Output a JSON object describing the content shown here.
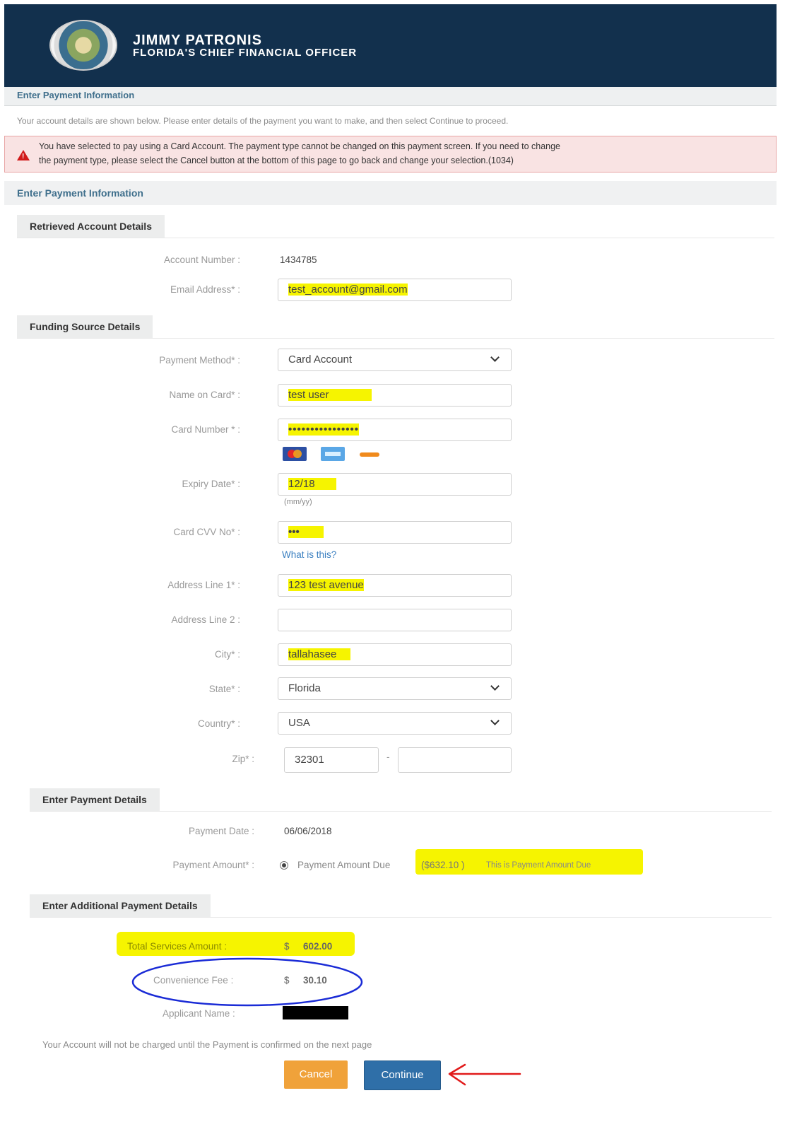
{
  "header": {
    "name": "JIMMY PATRONIS",
    "subtitle": "FLORIDA'S CHIEF FINANCIAL OFFICER"
  },
  "top_title": "Enter Payment Information",
  "intro": "Your account details are shown below. Please enter details of the payment you want to make, and then select Continue to proceed.",
  "alert": {
    "line1": "You have selected to pay using a Card Account. The payment type cannot be changed on this payment screen. If you need to change",
    "line2": "the payment type, please select the Cancel button at the bottom of this page to go back and change your selection.(1034)"
  },
  "page_heading": "Enter Payment Information",
  "retrieved": {
    "title": "Retrieved Account Details",
    "account_number_label": "Account Number :",
    "account_number": "1434785",
    "email_label": "Email Address* :",
    "email": "test_account@gmail.com"
  },
  "funding": {
    "title": "Funding Source Details",
    "payment_method_label": "Payment Method* :",
    "payment_method": "Card Account",
    "name_label": "Name on Card* :",
    "name": "test user",
    "card_number_label": "Card Number * :",
    "card_number": "••••••••••••••••",
    "expiry_label": "Expiry Date* :",
    "expiry": "12/18",
    "expiry_hint": "(mm/yy)",
    "cvv_label": "Card CVV No* :",
    "cvv": "•••",
    "cvv_help": "What is this?",
    "address1_label": "Address Line 1* :",
    "address1": "123 test avenue",
    "address2_label": "Address Line 2 :",
    "address2": "",
    "city_label": "City* :",
    "city": "tallahasee",
    "state_label": "State* :",
    "state": "Florida",
    "country_label": "Country* :",
    "country": "USA",
    "zip_label": "Zip* :",
    "zip": "32301",
    "zip_sep": "-",
    "zip_ext": ""
  },
  "payment": {
    "title": "Enter Payment Details",
    "date_label": "Payment Date :",
    "date": "06/06/2018",
    "amount_label": "Payment Amount* :",
    "amount_option": "Payment Amount Due",
    "amount_value": "($632.10 )",
    "amount_note": "This is Payment Amount Due"
  },
  "additional": {
    "title": "Enter Additional Payment Details",
    "total_label": "Total Services Amount :",
    "total_currency": "$",
    "total": "602.00",
    "fee_label": "Convenience Fee :",
    "fee_currency": "$",
    "fee": "30.10",
    "applicant_label": "Applicant Name :"
  },
  "footer_note": "Your Account will not be charged until the Payment is confirmed on the next page",
  "buttons": {
    "cancel": "Cancel",
    "continue": "Continue"
  },
  "colors": {
    "header": "#12304d",
    "highlight": "#f6f400",
    "cancel": "#f0a23a",
    "continue": "#2f6fa8",
    "annotation": "#1a2bd6",
    "arrow": "#e11b1b"
  }
}
